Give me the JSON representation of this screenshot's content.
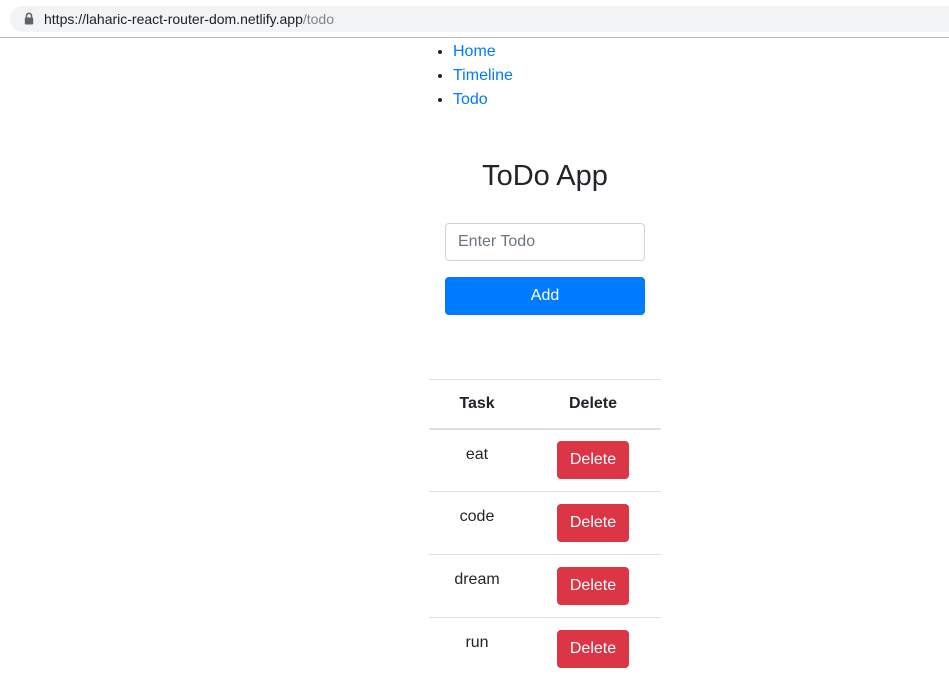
{
  "browser": {
    "url_host": "https://laharic-react-router-dom.netlify.app",
    "url_path": "/todo"
  },
  "nav": {
    "items": [
      {
        "label": "Home"
      },
      {
        "label": "Timeline"
      },
      {
        "label": "Todo"
      }
    ]
  },
  "title": "ToDo App",
  "form": {
    "placeholder": "Enter Todo",
    "value": "",
    "add_label": "Add"
  },
  "table": {
    "headers": {
      "task": "Task",
      "delete": "Delete"
    },
    "rows": [
      {
        "task": "eat",
        "action": "Delete"
      },
      {
        "task": "code",
        "action": "Delete"
      },
      {
        "task": "dream",
        "action": "Delete"
      },
      {
        "task": "run",
        "action": "Delete"
      }
    ]
  },
  "colors": {
    "primary": "#007bff",
    "danger": "#dc3545",
    "link": "#007bff",
    "text": "#212529"
  },
  "icons": {
    "lock": "lock-icon"
  }
}
